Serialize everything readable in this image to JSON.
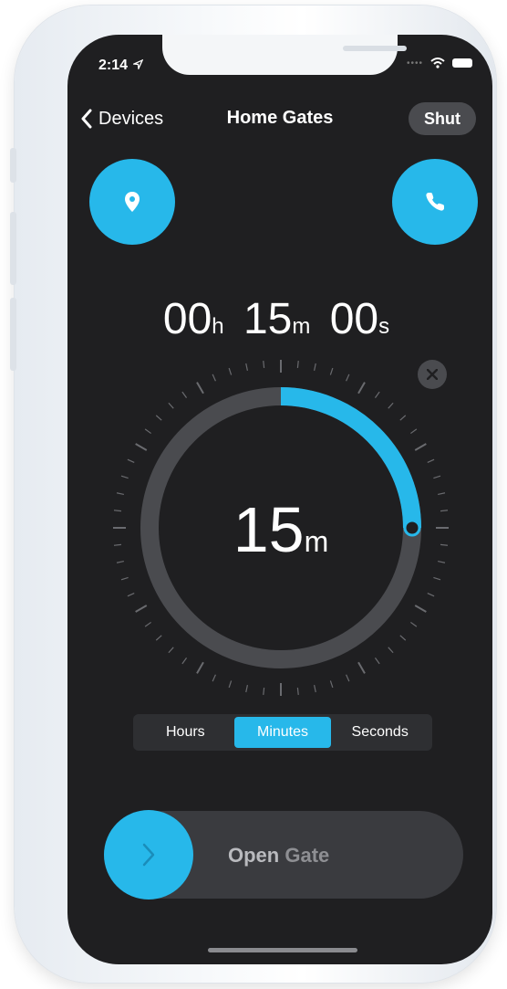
{
  "status": {
    "time": "2:14"
  },
  "nav": {
    "back_label": "Devices",
    "title": "Home Gates",
    "shut_label": "Shut"
  },
  "timer": {
    "hours": "00",
    "hours_unit": "h",
    "minutes": "15",
    "minutes_unit": "m",
    "seconds": "00",
    "seconds_unit": "s"
  },
  "dial": {
    "value": "15",
    "unit": "m",
    "progress_fraction": 0.25
  },
  "segments": [
    "Hours",
    "Minutes",
    "Seconds"
  ],
  "selected_segment": "Minutes",
  "slider": {
    "label_bold": "Open",
    "label_rest": " Gate"
  },
  "colors": {
    "accent": "#27b8ea",
    "background": "#1f1f21",
    "track": "#4a4b4f"
  }
}
